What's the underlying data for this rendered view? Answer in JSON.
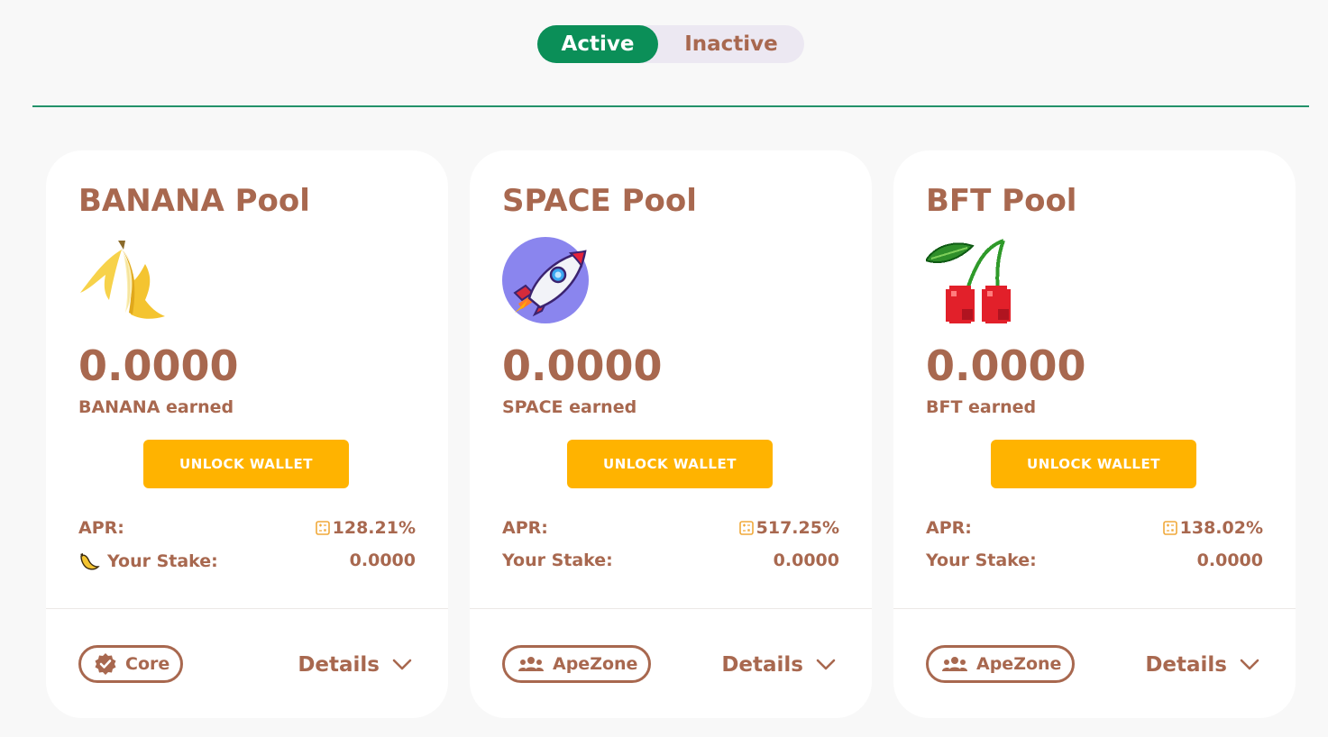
{
  "tabs": {
    "active_label": "Active",
    "inactive_label": "Inactive"
  },
  "colors": {
    "brand_text": "#a8684f",
    "active_tab": "#0b8f58",
    "unlock_button": "#ffb300",
    "divider": "#23926a",
    "calculator_icon": "#f0a93a"
  },
  "pools": [
    {
      "title": "BANANA Pool",
      "icon": "banana-icon",
      "earned_value": "0.0000",
      "earned_label": "BANANA earned",
      "unlock_label": "UNLOCK WALLET",
      "apr_label": "APR:",
      "apr_value": "128.21%",
      "stake_label": "Your Stake:",
      "stake_value": "0.0000",
      "tag_label": "Core",
      "tag_icon": "verified-badge-icon",
      "details_label": "Details"
    },
    {
      "title": "SPACE Pool",
      "icon": "rocket-icon",
      "earned_value": "0.0000",
      "earned_label": "SPACE earned",
      "unlock_label": "UNLOCK WALLET",
      "apr_label": "APR:",
      "apr_value": "517.25%",
      "stake_label": "Your Stake:",
      "stake_value": "0.0000",
      "tag_label": "ApeZone",
      "tag_icon": "users-icon",
      "details_label": "Details"
    },
    {
      "title": "BFT Pool",
      "icon": "cherries-icon",
      "earned_value": "0.0000",
      "earned_label": "BFT earned",
      "unlock_label": "UNLOCK WALLET",
      "apr_label": "APR:",
      "apr_value": "138.02%",
      "stake_label": "Your Stake:",
      "stake_value": "0.0000",
      "tag_label": "ApeZone",
      "tag_icon": "users-icon",
      "details_label": "Details"
    }
  ]
}
